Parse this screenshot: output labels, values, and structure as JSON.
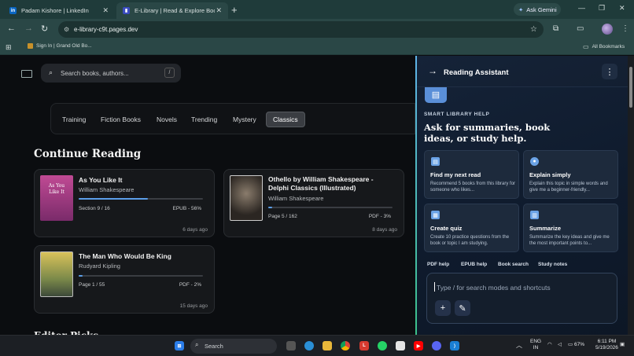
{
  "browser": {
    "tabs": [
      {
        "title": "Padam Kishore | LinkedIn",
        "icon": "linkedin-icon",
        "active": false
      },
      {
        "title": "E-Library | Read & Explore Books",
        "icon": "elibrary-icon",
        "active": true
      }
    ],
    "new_tab": "+",
    "gemini_label": "Ask Gemini",
    "url": "e-library-c9t.pages.dev",
    "bookmarks": [
      {
        "label": "Sign In | Grand Old Bo..."
      }
    ],
    "all_bookmarks": "All Bookmarks"
  },
  "app": {
    "search_placeholder": "Search books, authors...",
    "search_shortcut": "/",
    "categories": [
      "Training",
      "Fiction Books",
      "Novels",
      "Trending",
      "Mystery",
      "Classics"
    ],
    "selected_category": "Classics",
    "continue_heading": "Continue Reading",
    "books": [
      {
        "title": "As You Like It",
        "author": "William Shakespeare",
        "progress_label": "Section 9 / 16",
        "format": "EPUB - 56%",
        "progress": 0.56,
        "ago": "6 days ago",
        "cover_text": "As You Like It"
      },
      {
        "title_line1": "Othello by William Shakespeare -",
        "title_line2": "Delphi Classics (Illustrated)",
        "author": "William Shakespeare",
        "progress_label": "Page 5 / 162",
        "format": "PDF - 3%",
        "progress": 0.03,
        "ago": "8 days ago"
      },
      {
        "title": "The Man Who Would Be King",
        "author": "Rudyard Kipling",
        "progress_label": "Page 1 / 55",
        "format": "PDF - 2%",
        "progress": 0.02,
        "ago": "15 days ago"
      }
    ],
    "editor_heading": "Editor Picks"
  },
  "assistant": {
    "title": "Reading Assistant",
    "kicker": "SMART LIBRARY HELP",
    "heading": "Ask for summaries, book ideas, or study help.",
    "cards": [
      {
        "title": "Find my next read",
        "desc": "Recommend 5 books from this library for someone who likes...",
        "icon": "book-icon"
      },
      {
        "title": "Explain simply",
        "desc": "Explain this topic in simple words and give me a beginner-friendly...",
        "icon": "lightbulb-icon"
      },
      {
        "title": "Create quiz",
        "desc": "Create 10 practice questions from the book or topic I am studying.",
        "icon": "quiz-icon"
      },
      {
        "title": "Summarize",
        "desc": "Summarize the key ideas and give me the most important points to...",
        "icon": "document-icon"
      }
    ],
    "chips": [
      "PDF help",
      "EPUB help",
      "Book search",
      "Study notes"
    ],
    "composer_placeholder": "Type / for search modes and shortcuts"
  },
  "taskbar": {
    "search_label": "Search",
    "lang_line1": "ENG",
    "lang_line2": "IN",
    "battery": "67%",
    "time": "6:11 PM",
    "date": "5/19/2026"
  },
  "colors": {
    "accent_blue": "#5b9ee8",
    "assistant_bg": "#0f1b2d",
    "browser_teal": "#2a4746"
  }
}
